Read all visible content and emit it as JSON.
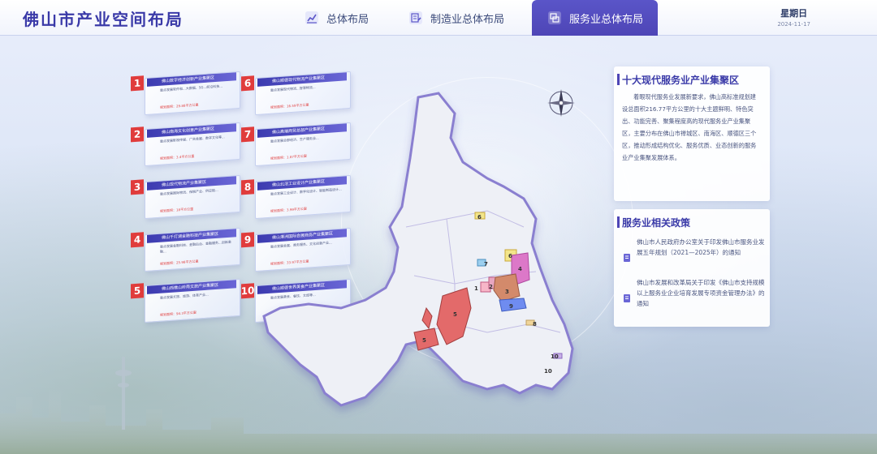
{
  "header": {
    "title": "佛山市产业空间布局",
    "tabs": [
      {
        "label": "总体布局",
        "icon": "chart-icon"
      },
      {
        "label": "制造业总体布局",
        "icon": "document-edit-icon"
      },
      {
        "label": "服务业总体布局",
        "icon": "layers-icon",
        "active": true
      }
    ],
    "weekday": "星期日",
    "date": "2024-11-17"
  },
  "clusters": [
    {
      "num": "1",
      "title": "佛山数字经济创新产业集聚区",
      "desc": "重点发展软件和...大数据、5G...前沿科技...",
      "area": "规划面积：29.88平方公里"
    },
    {
      "num": "2",
      "title": "佛山南海文化创意产业集聚区",
      "desc": "重点发展影视传媒、广告会展、数字文化等...",
      "area": "规划面积：3.4平方公里"
    },
    {
      "num": "3",
      "title": "佛山现代物流产业集聚区",
      "desc": "重点发展国际物流、保税产业、供应链...",
      "area": "规划面积：18平方公里"
    },
    {
      "num": "4",
      "title": "佛山千灯湖金融科技产业集聚区",
      "desc": "重点发展金融科技、金融后台、金融服务...创新金融...",
      "area": "规划面积：25.98平方公里"
    },
    {
      "num": "5",
      "title": "佛山西樵山岭南文旅产业集聚区",
      "desc": "重点发展文旅、旅游、体育产业...",
      "area": "规划面积：94.3平方公里"
    },
    {
      "num": "6",
      "title": "佛山顺德现代物流产业集聚区",
      "desc": "重点发展现代物流...智慧物流...",
      "area": "规划面积：16.59平方公里"
    },
    {
      "num": "7",
      "title": "佛山高端商贸总部产业集聚区",
      "desc": "重点发展总部经济、生产服务业...",
      "area": "规划面积：1.87平方公里"
    },
    {
      "num": "8",
      "title": "佛山北滘工业设计产业集聚区",
      "desc": "重点发展工业设计、数字化设计、智能制造设计...",
      "area": "规划面积：3.99平方公里"
    },
    {
      "num": "9",
      "title": "佛山潭洲国际会展商务产业集聚区",
      "desc": "重点发展会展、商务服务、文化创意产业...",
      "area": "规划面积：33.97平方公里"
    },
    {
      "num": "10",
      "title": "佛山顺德世界美食产业集聚区",
      "desc": "重点发展美食、餐饮、文旅等...",
      "area": "规划面积：6.09平方公里"
    }
  ],
  "map": {
    "labels": [
      "1",
      "2",
      "3",
      "4",
      "5",
      "5",
      "6",
      "6",
      "7",
      "8",
      "9",
      "10",
      "10"
    ]
  },
  "panel_top": {
    "title": "十大现代服务业产业集聚区",
    "body": "着眼现代服务业发展新要求，佛山高标准规划建设总面积216.77平方公里的十大主题鲜明、特色突出、功能完善、聚集程度高的现代服务业产业集聚区，主要分布在佛山市禅城区、南海区、顺德区三个区，推动形成结构优化、服务优质、业态创新的服务业产业集聚发展体系。"
  },
  "panel_policy": {
    "title": "服务业相关政策",
    "items": [
      "佛山市人民政府办公室关于印发佛山市服务业发展五年规划（2021—2025年）的通知",
      "佛山市发展和改革局关于印发《佛山市支持规模以上服务业企业培育发展专项资金管理办法》的通知"
    ]
  },
  "colors": {
    "accent": "#4e45b6",
    "title": "#3a3aa8",
    "badge": "#e03c3c"
  }
}
